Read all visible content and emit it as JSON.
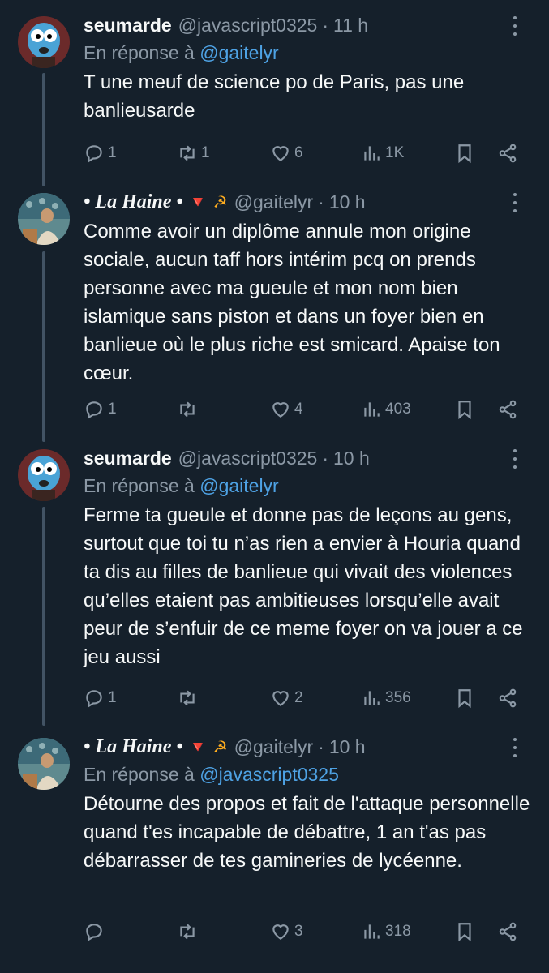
{
  "tweets": [
    {
      "author": "seumarde",
      "handle": "@javascript0325",
      "dot": "·",
      "time": "11 h",
      "reply_prefix": "En réponse à",
      "reply_mention": "@gaitelyr",
      "text": "T une meuf de science po de Paris, pas une banlieusarde",
      "replies": "1",
      "retweets": "1",
      "likes": "6",
      "views": "1K"
    },
    {
      "author": "• La Haine •",
      "emoji_1": "🔻",
      "emoji_2": "☭",
      "handle": "@gaitelyr",
      "dot": "·",
      "time": "10 h",
      "text": "Comme avoir un diplôme annule mon origine sociale, aucun taff hors intérim pcq on prends personne avec ma gueule et mon nom bien islamique sans piston et dans un foyer bien en banlieue où le plus riche est smicard. Apaise ton cœur.",
      "replies": "1",
      "retweets": "",
      "likes": "4",
      "views": "403"
    },
    {
      "author": "seumarde",
      "handle": "@javascript0325",
      "dot": "·",
      "time": "10 h",
      "reply_prefix": "En réponse à",
      "reply_mention": "@gaitelyr",
      "text": "Ferme ta gueule et donne pas de leçons au gens, surtout que toi tu n’as rien a envier à Houria quand ta dis au filles de banlieue qui vivait des violences qu’elles etaient pas ambitieuses lorsqu’elle avait peur de s’enfuir de ce meme foyer on va jouer a ce jeu aussi",
      "replies": "1",
      "retweets": "",
      "likes": "2",
      "views": "356"
    },
    {
      "author": "• La Haine •",
      "emoji_1": "🔻",
      "emoji_2": "☭",
      "handle": "@gaitelyr",
      "dot": "·",
      "time": "10 h",
      "reply_prefix": "En réponse à",
      "reply_mention": "@javascript0325",
      "text": "Détourne des propos et fait de l'attaque personnelle quand t'es incapable de débattre, 1 an t'as pas débarrasser de tes gamineries de lycéenne.",
      "replies": "",
      "retweets": "",
      "likes": "3",
      "views": "318"
    }
  ],
  "colors": {
    "background": "#15202b",
    "text": "#f7f9f9",
    "muted": "#8b98a5",
    "link": "#4ea2e4",
    "thread_line": "#425364"
  },
  "icons": [
    "reply-icon",
    "retweet-icon",
    "like-icon",
    "views-icon",
    "bookmark-icon",
    "share-icon",
    "more-icon"
  ]
}
